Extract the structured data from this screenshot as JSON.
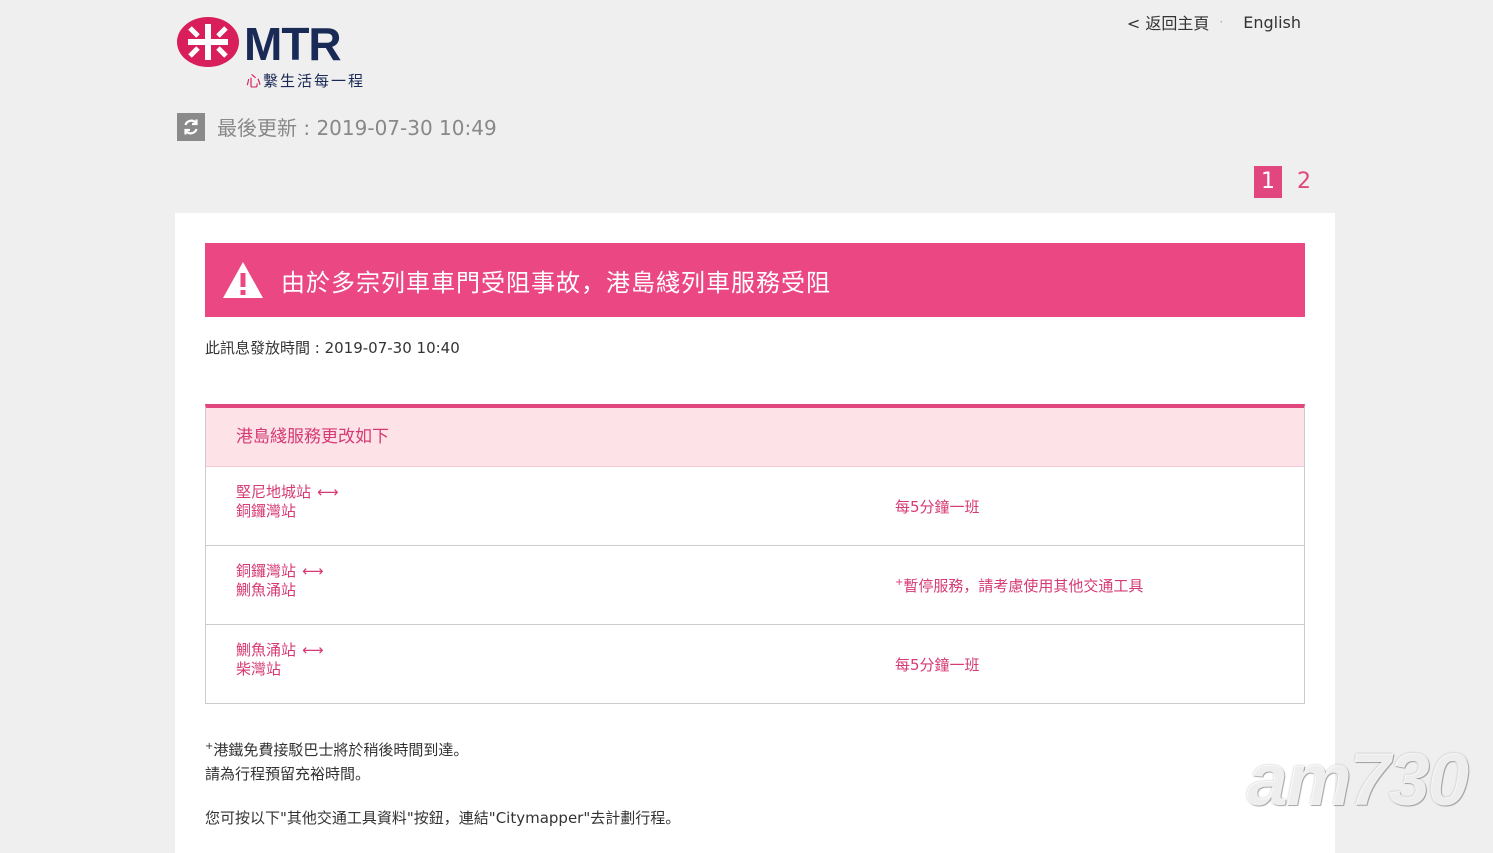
{
  "brand": {
    "name": "MTR",
    "tagline_heart": "心",
    "tagline_rest": "繫生活每一程",
    "red": "#d81e5b",
    "navy": "#1a2a56"
  },
  "nav": {
    "back_label": "< 返回主頁",
    "sep": "·",
    "lang_label": "English"
  },
  "update": {
    "text": "最後更新 : 2019-07-30 10:49"
  },
  "pager": [
    "1",
    "2"
  ],
  "alert": {
    "title": "由於多宗列車車門受阻事故，港島綫列車服務受阻",
    "color": "#ea4783",
    "issued": "此訊息發放時間 : 2019-07-30 10:40"
  },
  "service": {
    "header": "港島綫服務更改如下",
    "rows": [
      {
        "from": "堅尼地城站",
        "to": "銅鑼灣站",
        "arrow": "⟷",
        "mark": "",
        "status": "每5分鐘一班"
      },
      {
        "from": "銅鑼灣站",
        "to": "鰂魚涌站",
        "arrow": "⟷",
        "mark": "+",
        "status": "暫停服務，請考慮使用其他交通工具"
      },
      {
        "from": "鰂魚涌站",
        "to": "柴灣站",
        "arrow": "⟷",
        "mark": "",
        "status": "每5分鐘一班"
      }
    ]
  },
  "notes": {
    "mark": "+",
    "line1": "港鐵免費接駁巴士將於稍後時間到達。",
    "line2": "請為行程預留充裕時間。",
    "citymapper": "您可按以下\"其他交通工具資料\"按鈕，連結\"Citymapper\"去計劃行程。"
  },
  "watermark": "am730"
}
